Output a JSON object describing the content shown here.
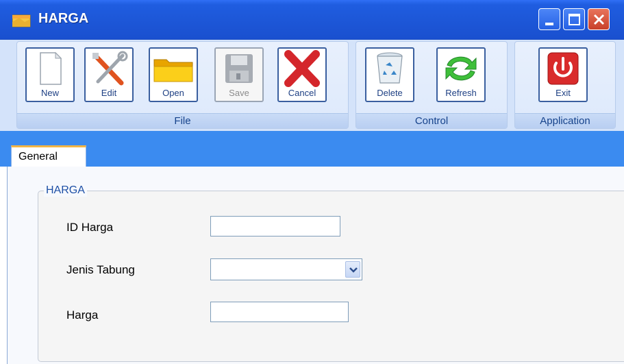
{
  "window": {
    "title": "HARGA",
    "controls": [
      "minimize",
      "maximize",
      "close"
    ]
  },
  "ribbon": {
    "groups": [
      {
        "label": "File",
        "buttons": [
          {
            "label": "New",
            "icon": "new-document-icon",
            "enabled": true
          },
          {
            "label": "Edit",
            "icon": "tools-icon",
            "enabled": true
          },
          {
            "label": "Open",
            "icon": "folder-icon",
            "enabled": true
          },
          {
            "label": "Save",
            "icon": "floppy-disk-icon",
            "enabled": false
          },
          {
            "label": "Cancel",
            "icon": "red-x-icon",
            "enabled": true
          }
        ]
      },
      {
        "label": "Control",
        "buttons": [
          {
            "label": "Delete",
            "icon": "recycle-bin-icon",
            "enabled": true
          },
          {
            "label": "Refresh",
            "icon": "refresh-arrows-icon",
            "enabled": true
          }
        ]
      },
      {
        "label": "Application",
        "buttons": [
          {
            "label": "Exit",
            "icon": "power-icon",
            "enabled": true
          }
        ]
      }
    ]
  },
  "tabs": [
    {
      "label": "General",
      "active": true
    }
  ],
  "form": {
    "group_title": "HARGA",
    "fields": [
      {
        "label": "ID Harga",
        "type": "text",
        "value": ""
      },
      {
        "label": "Jenis Tabung",
        "type": "select",
        "value": ""
      },
      {
        "label": "Harga",
        "type": "text",
        "value": ""
      }
    ]
  },
  "colors": {
    "titlebar": "#1f5de0",
    "ribbon_bg": "#d4e3fa",
    "group_label_text": "#15428b",
    "strip": "#3b8bf0",
    "tab_accent": "#f2b545",
    "legend_text": "#1e50a6"
  }
}
